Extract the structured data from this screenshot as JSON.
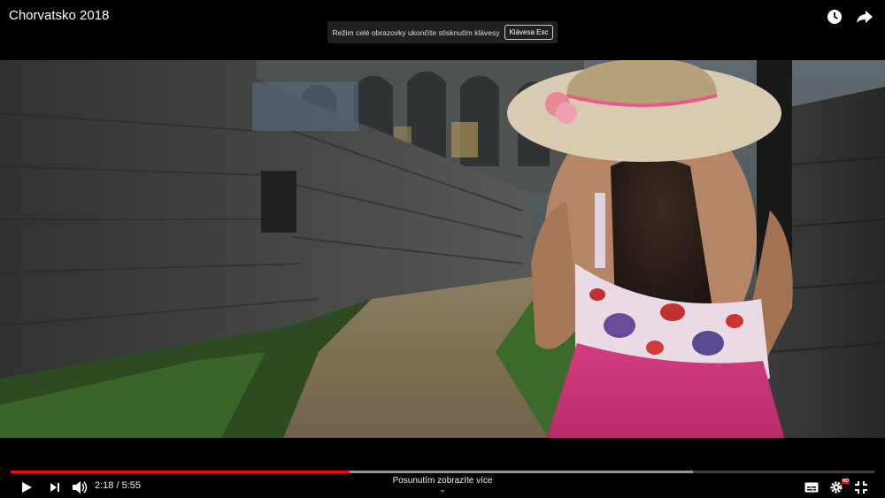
{
  "header": {
    "title": "Chorvatsko 2018"
  },
  "fullscreen_notice": {
    "message": "Režim celé obrazovky ukončíte stisknutím klávesy",
    "key_label": "Klávesa Esc"
  },
  "player": {
    "progress": {
      "played_fraction": 0.392,
      "buffered_fraction": 0.79
    },
    "time_display": "2:18 / 5:55",
    "scroll_hint": "Posunutím zobrazíte více",
    "quality_badge": "HD"
  },
  "icons": {
    "watch_later": "clock-icon",
    "share": "share-arrow-icon",
    "play": "play-icon",
    "next": "next-icon",
    "volume": "volume-icon",
    "subtitles": "subtitles-icon",
    "settings": "gear-icon",
    "exit_fullscreen": "exit-fullscreen-icon"
  },
  "colors": {
    "progress_played": "#ff0000",
    "background": "#000000"
  }
}
